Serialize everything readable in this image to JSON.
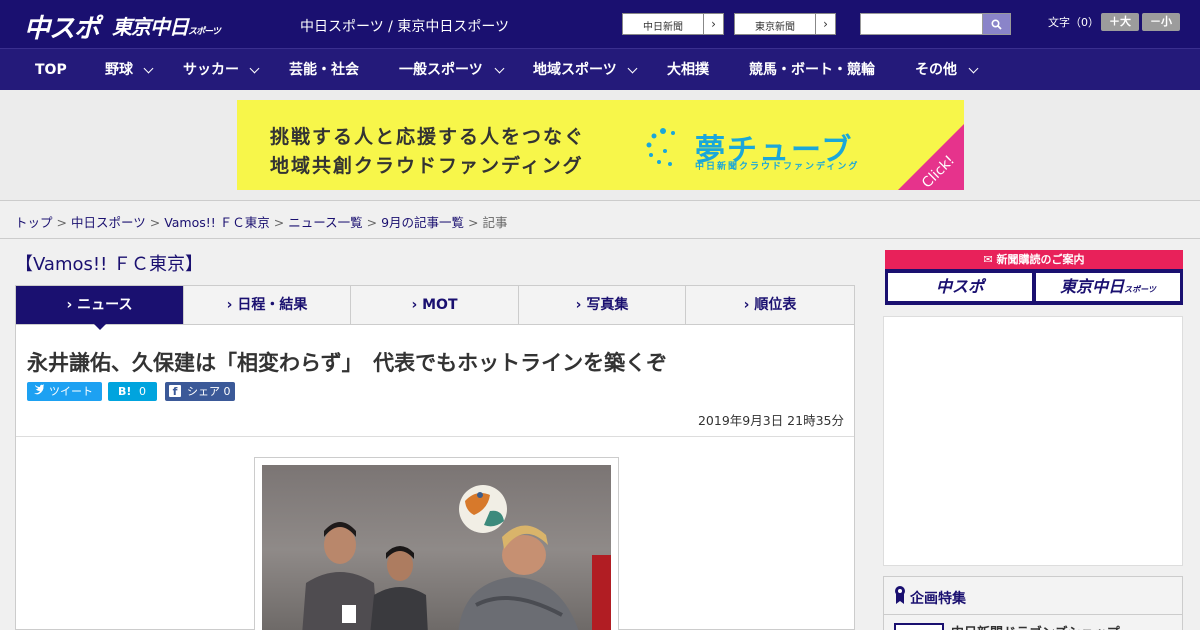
{
  "header": {
    "logo_chuspo": "中スポ",
    "logo_tokyo": "東京中日",
    "logo_tokyo_small": "スポーツ",
    "site_title": "中日スポーツ / 東京中日スポーツ",
    "paper_buttons": [
      {
        "label": "中日新聞"
      },
      {
        "label": "東京新聞"
      }
    ],
    "search_placeholder": "",
    "font_size_label": "文字（0）",
    "font_larger": "＋大",
    "font_smaller": "－小"
  },
  "nav": {
    "items": [
      {
        "label": "TOP",
        "has_menu": false
      },
      {
        "label": "野球",
        "has_menu": true
      },
      {
        "label": "サッカー",
        "has_menu": true
      },
      {
        "label": "芸能・社会",
        "has_menu": false
      },
      {
        "label": "一般スポーツ",
        "has_menu": true
      },
      {
        "label": "地域スポーツ",
        "has_menu": true
      },
      {
        "label": "大相撲",
        "has_menu": false
      },
      {
        "label": "競馬・ボート・競輪",
        "has_menu": false
      },
      {
        "label": "その他",
        "has_menu": true
      }
    ]
  },
  "banner": {
    "line1": "挑戦する人と応援する人をつなぐ",
    "line2": "地域共創クラウドファンディング",
    "brand": "夢チューブ",
    "brand_sub": "中日新聞クラウドファンディング",
    "click": "Click!",
    "colors": {
      "background": "#f7f64a",
      "brand": "#1aa7d9",
      "corner": "#e6338c"
    }
  },
  "breadcrumb": {
    "items": [
      "トップ",
      "中日スポーツ",
      "Vamos!! ＦＣ東京",
      "ニュース一覧",
      "9月の記事一覧"
    ],
    "current": "記事",
    "separator": ">"
  },
  "section": {
    "title": "【Vamos!! ＦＣ東京】",
    "tabs": [
      {
        "label": "ニュース",
        "active": true
      },
      {
        "label": "日程・結果",
        "active": false
      },
      {
        "label": "MOT",
        "active": false
      },
      {
        "label": "写真集",
        "active": false
      },
      {
        "label": "順位表",
        "active": false
      }
    ]
  },
  "article": {
    "title": "永井謙佑、久保建は「相変わらず」　代表でもホットラインを築くぞ",
    "share": {
      "tweet": "ツイート",
      "hatena_icon": "B!",
      "hatena_count": "0",
      "facebook": "シェア",
      "facebook_count": "0"
    },
    "date": "2019年9月3日 21時35分"
  },
  "sidebar": {
    "subscribe_title": "新聞購読のご案内",
    "subscribe_buttons": [
      "中スポ",
      "東京中日"
    ],
    "subscribe_small": "スポーツ",
    "feature_title": "企画特集",
    "feature_item": "中日新聞ドラゴンズショップ"
  },
  "colors": {
    "header_bg": "#1a1070",
    "nav_bg": "#241a7a",
    "accent_red": "#e8215a",
    "twitter": "#1da1f2",
    "hatena": "#00a4de",
    "facebook": "#3b5998"
  }
}
